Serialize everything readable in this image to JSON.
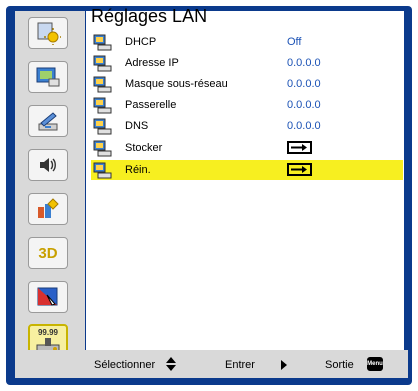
{
  "menu": {
    "title": "Réglages LAN",
    "rows": [
      {
        "label": "DHCP",
        "value": "Off",
        "type": "value"
      },
      {
        "label": "Adresse IP",
        "value": "0.0.0.0",
        "type": "value"
      },
      {
        "label": "Masque sous-réseau",
        "value": "0.0.0.0",
        "type": "value"
      },
      {
        "label": "Passerelle",
        "value": "0.0.0.0",
        "type": "value"
      },
      {
        "label": "DNS",
        "value": "0.0.0.0",
        "type": "value"
      },
      {
        "label": "Stocker",
        "value": "",
        "type": "arrow"
      },
      {
        "label": "Réin.",
        "value": "",
        "type": "arrow",
        "selected": true
      }
    ]
  },
  "sidebar": {
    "icons": [
      "image-settings-icon",
      "display-settings-icon",
      "setup-icon",
      "volume-icon",
      "options-icon",
      "3d-icon",
      "interactive-icon",
      "network-icon"
    ],
    "labels": [
      "3D",
      "99.99"
    ],
    "active_index": 7
  },
  "footer": {
    "select_label": "Sélectionner",
    "enter_label": "Entrer",
    "exit_label": "Sortie",
    "menu_key": "Menu"
  },
  "colors": {
    "frame": "#0b3a8c",
    "panel": "#d9d9d9",
    "highlight": "#f7ef20",
    "value_text": "#1b52b5"
  }
}
